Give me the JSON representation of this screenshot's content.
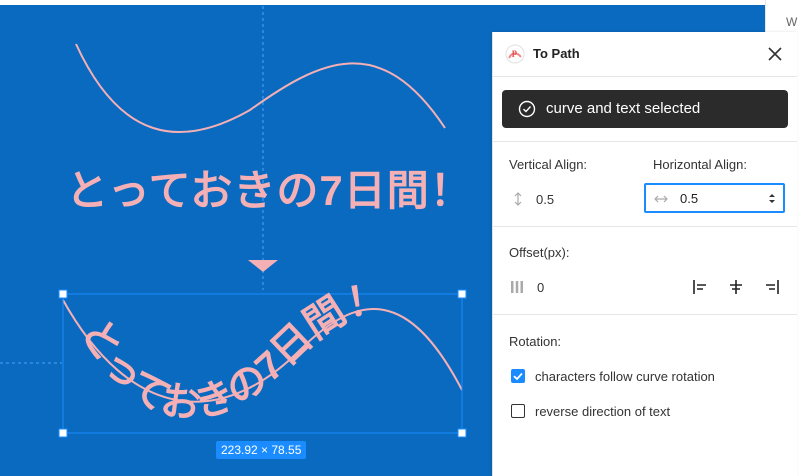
{
  "canvas": {
    "title_text": "とっておきの7日間！",
    "curved_text": "とっておきの7日間！",
    "selection_size": "223.92 × 78.55",
    "background": "#0a6ac0",
    "text_color": "#f4b0b4"
  },
  "right_strip": {
    "letter": "W"
  },
  "panel": {
    "title": "To Path",
    "toast": "curve and text selected",
    "vertical_align_label": "Vertical Align:",
    "vertical_align_value": "0.5",
    "horizontal_align_label": "Horizontal Align:",
    "horizontal_align_value": "0.5",
    "offset_label": "Offset(px):",
    "offset_value": "0",
    "rotation_label": "Rotation:",
    "follow_rotation_label": "characters follow curve rotation",
    "follow_rotation_checked": true,
    "reverse_direction_label": "reverse direction of text",
    "reverse_direction_checked": false,
    "accent": "#1a8cff"
  }
}
